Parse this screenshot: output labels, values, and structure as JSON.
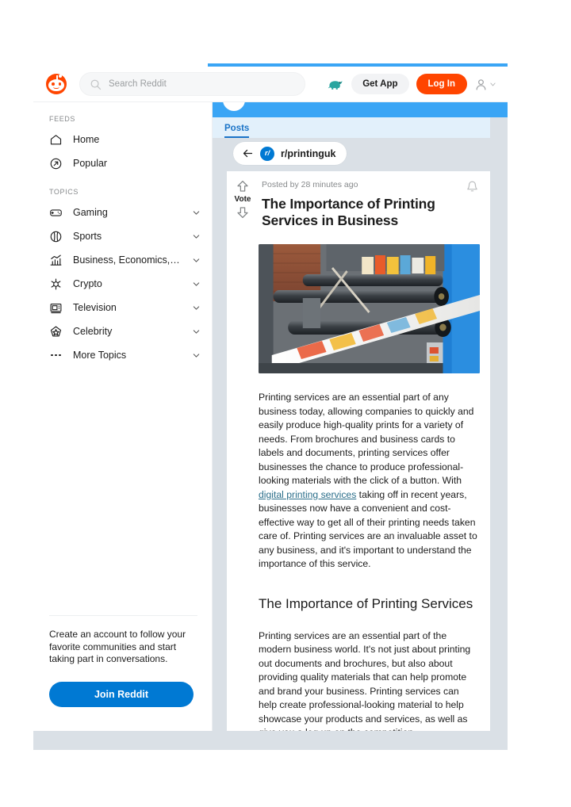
{
  "header": {
    "logo_name": "reddit-logo",
    "search_placeholder": "Search Reddit",
    "search_value": "",
    "mascot_icon": "dinosaur-mascot-icon",
    "get_app_label": "Get App",
    "log_in_label": "Log In",
    "user_icon": "user-avatar-icon",
    "caret_icon": "chevron-down-icon"
  },
  "sidebar": {
    "feeds_label": "FEEDS",
    "feeds": [
      {
        "label": "Home",
        "icon": "home-icon"
      },
      {
        "label": "Popular",
        "icon": "trending-arrow-icon"
      }
    ],
    "topics_label": "TOPICS",
    "topics": [
      {
        "label": "Gaming",
        "icon": "gamepad-icon"
      },
      {
        "label": "Sports",
        "icon": "baseball-icon"
      },
      {
        "label": "Business, Economics, an...",
        "icon": "bar-chart-icon"
      },
      {
        "label": "Crypto",
        "icon": "crypto-gear-icon"
      },
      {
        "label": "Television",
        "icon": "television-icon"
      },
      {
        "label": "Celebrity",
        "icon": "star-badge-icon"
      },
      {
        "label": "More Topics",
        "icon": "ellipsis-icon"
      }
    ],
    "cta_text": "Create an account to follow your favorite communities and start taking part in conversations.",
    "join_label": "Join Reddit"
  },
  "main": {
    "tab_label": "Posts",
    "back_icon": "back-arrow-icon",
    "subreddit_avatar_text": "r/",
    "subreddit_name": "r/printinguk"
  },
  "post": {
    "vote_label": "Vote",
    "upvote_icon": "upvote-arrow-icon",
    "downvote_icon": "downvote-arrow-icon",
    "bell_icon": "notification-bell-icon",
    "posted_by": "Posted by 28 minutes ago",
    "title": "The Importance of Printing Services in Business",
    "image_alt": "printing-press-photo",
    "paragraph_1_before_link": "Printing services are an essential part of any business today, allowing companies to quickly and easily produce high-quality prints for a variety of needs. From brochures and business cards to labels and documents, printing services offer businesses the chance to produce professional-looking materials with the click of a button. With ",
    "paragraph_1_link": "digital printing services",
    "paragraph_1_after_link": " taking off in recent years, businesses now have a convenient and cost-effective way to get all of their printing needs taken care of. Printing services are an invaluable asset to any business, and it's important to understand the importance of this service.",
    "heading_2": "The Importance of Printing Services",
    "paragraph_2": "Printing services are an essential part of the modern business world. It's not just about printing out documents and brochures, but also about providing quality materials that can help promote and brand your business. Printing services can help create professional-looking material to help showcase your products and services, as well as give you a leg up on the competition."
  },
  "colors": {
    "reddit_orange": "#ff4500",
    "link_blue": "#0079d3",
    "banner_blue": "#3aa5f5",
    "tab_blue": "#1a73c7",
    "page_gray": "#dae0e6",
    "anchor_teal": "#2a6e8a",
    "mascot_teal": "#2aa5a0"
  }
}
